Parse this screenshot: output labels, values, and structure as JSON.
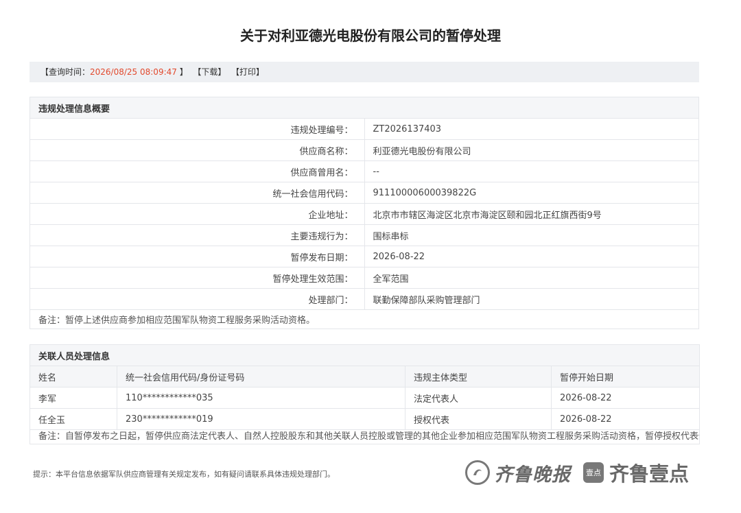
{
  "page": {
    "title": "关于对利亚德光电股份有限公司的暂停处理"
  },
  "query": {
    "label_prefix": "【查询时间：",
    "time": "2026/08/25 08:09:47",
    "label_suffix": " 】",
    "download": "【下载】",
    "print": "【打印】"
  },
  "summary": {
    "heading": "违规处理信息概要",
    "rows": [
      {
        "label": "违规处理编号：",
        "value": "ZT2026137403"
      },
      {
        "label": "供应商名称：",
        "value": "利亚德光电股份有限公司"
      },
      {
        "label": "供应商曾用名：",
        "value": "--"
      },
      {
        "label": "统一社会信用代码：",
        "value": "91110000600039822G"
      },
      {
        "label": "企业地址：",
        "value": "北京市市辖区海淀区北京市海淀区颐和园北正红旗西街9号"
      },
      {
        "label": "主要违规行为：",
        "value": "围标串标"
      },
      {
        "label": "暂停发布日期：",
        "value": "2026-08-22"
      },
      {
        "label": "暂停处理生效范围：",
        "value": "全军范围"
      },
      {
        "label": "处理部门：",
        "value": "联勤保障部队采购管理部门"
      }
    ],
    "note": "备注：暂停上述供应商参加相应范围军队物资工程服务采购活动资格。"
  },
  "persons": {
    "heading": "关联人员处理信息",
    "columns": [
      "姓名",
      "统一社会信用代码/身份证号码",
      "违规主体类型",
      "暂停开始日期"
    ],
    "rows": [
      [
        "李军",
        "110************035",
        "法定代表人",
        "2026-08-22"
      ],
      [
        "任全玉",
        "230************019",
        "授权代表",
        "2026-08-22"
      ]
    ],
    "note": "备注：自暂停发布之日起，暂停供应商法定代表人、自然人控股股东和其他关联人员控股或管理的其他企业参加相应范围军队物资工程服务采购活动资格，暂停授权代表代理其他供应商参加相应范围军队物资工程服务采购活动资格。"
  },
  "footer": {
    "tip": "提示：本平台信息依据军队供应商管理有关规定发布，如有疑问请联系具体违规处理部门。"
  },
  "watermark": {
    "brand1": "齐鲁晚报",
    "badge": "壹点",
    "brand2": "齐鲁壹点"
  }
}
